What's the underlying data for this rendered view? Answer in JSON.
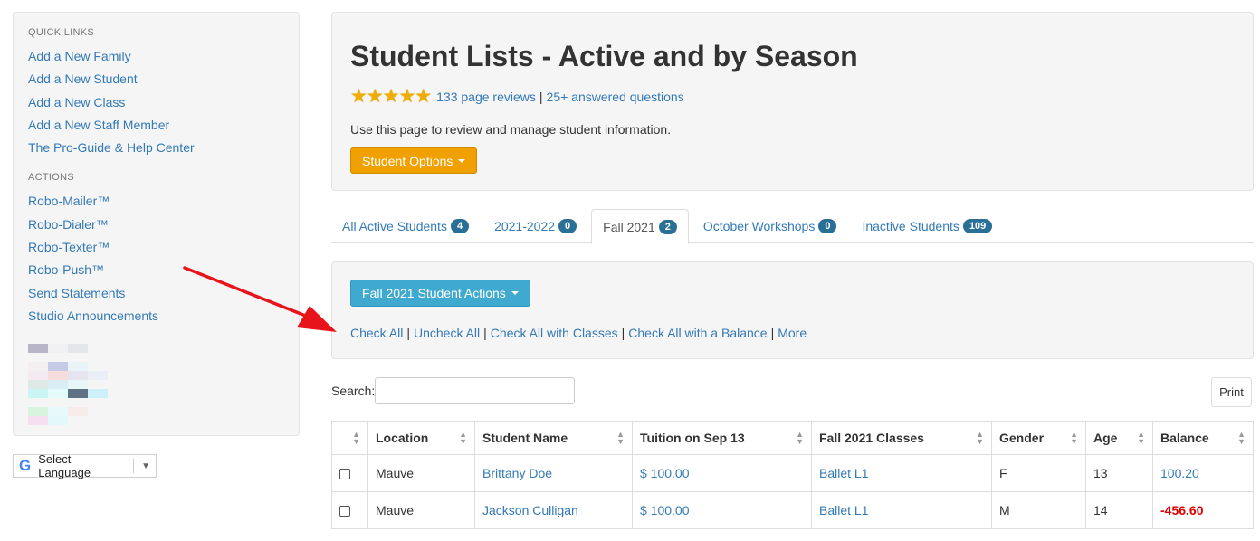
{
  "sidebar": {
    "quick_links_heading": "QUICK LINKS",
    "quick_links": [
      "Add a New Family",
      "Add a New Student",
      "Add a New Class",
      "Add a New Staff Member",
      "The Pro-Guide & Help Center"
    ],
    "actions_heading": "ACTIONS",
    "actions": [
      "Robo-Mailer™",
      "Robo-Dialer™",
      "Robo-Texter™",
      "Robo-Push™",
      "Send Statements",
      "Studio Announcements"
    ]
  },
  "language": {
    "g_logo": "G",
    "label": "Select Language",
    "arrow": "▼"
  },
  "header": {
    "title": "Student Lists - Active and by Season",
    "stars": "★★★★★",
    "reviews": "133 page reviews",
    "questions": "25+ answered questions",
    "description": "Use this page to review and manage student information.",
    "options_button": "Student Options"
  },
  "tabs": [
    {
      "label": "All Active Students",
      "count": "4"
    },
    {
      "label": "2021-2022",
      "count": "0"
    },
    {
      "label": "Fall 2021",
      "count": "2"
    },
    {
      "label": "October Workshops",
      "count": "0"
    },
    {
      "label": "Inactive Students",
      "count": "109"
    }
  ],
  "actions_panel": {
    "button": "Fall 2021 Student Actions",
    "links": [
      "Check All",
      "Uncheck All",
      "Check All with Classes",
      "Check All with a Balance",
      "More"
    ]
  },
  "search": {
    "label": "Search:",
    "value": ""
  },
  "print_label": "Print",
  "table": {
    "columns": [
      "",
      "Location",
      "Student Name",
      "Tuition on Sep 13",
      "Fall 2021 Classes",
      "Gender",
      "Age",
      "Balance"
    ],
    "rows": [
      {
        "location": "Mauve",
        "name": "Brittany Doe",
        "tuition": "$ 100.00",
        "classes": "Ballet L1",
        "gender": "F",
        "age": "13",
        "balance": "100.20"
      },
      {
        "location": "Mauve",
        "name": "Jackson Culligan",
        "tuition": "$ 100.00",
        "classes": "Ballet L1",
        "gender": "M",
        "age": "14",
        "balance": "-456.60"
      }
    ]
  },
  "colors": {
    "link": "#337ab7",
    "orange_button": "#f0a000",
    "blue_button": "#3fa9cf",
    "badge": "#2a6f96",
    "negative_balance": "#e00000",
    "arrow": "#e8141c"
  }
}
